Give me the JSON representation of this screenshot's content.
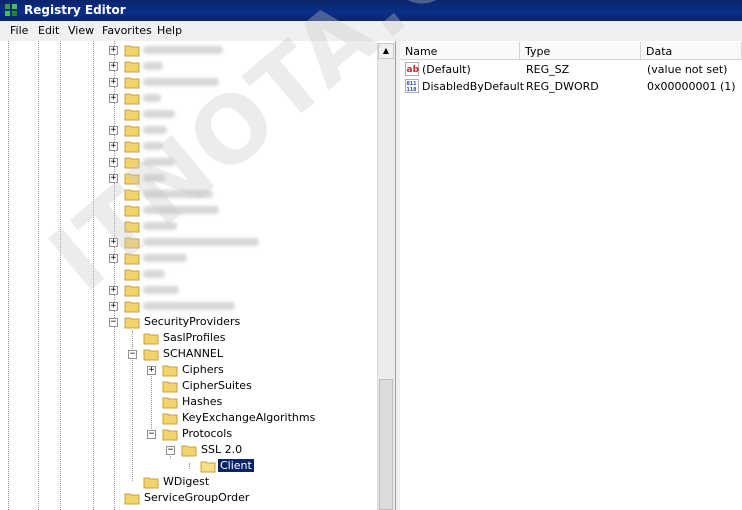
{
  "window": {
    "title": "Registry Editor"
  },
  "menu": [
    "File",
    "Edit",
    "View",
    "Favorites",
    "Help"
  ],
  "tree": {
    "security_providers": "SecurityProviders",
    "sasl_profiles": "SaslProfiles",
    "schannel": "SCHANNEL",
    "ciphers": "Ciphers",
    "cipher_suites": "CipherSuites",
    "hashes": "Hashes",
    "key_exchange": "KeyExchangeAlgorithms",
    "protocols": "Protocols",
    "ssl20": "SSL 2.0",
    "client": "Client",
    "wdigest": "WDigest",
    "service_group_order": "ServiceGroupOrder"
  },
  "list": {
    "columns": [
      "Name",
      "Type",
      "Data"
    ],
    "rows": [
      {
        "name": "(Default)",
        "type": "REG_SZ",
        "data": "(value not set)",
        "icon": "string-value-icon"
      },
      {
        "name": "DisabledByDefault",
        "type": "REG_DWORD",
        "data": "0x00000001 (1)",
        "icon": "binary-value-icon"
      }
    ]
  },
  "watermark": "ITNOTA.COM"
}
